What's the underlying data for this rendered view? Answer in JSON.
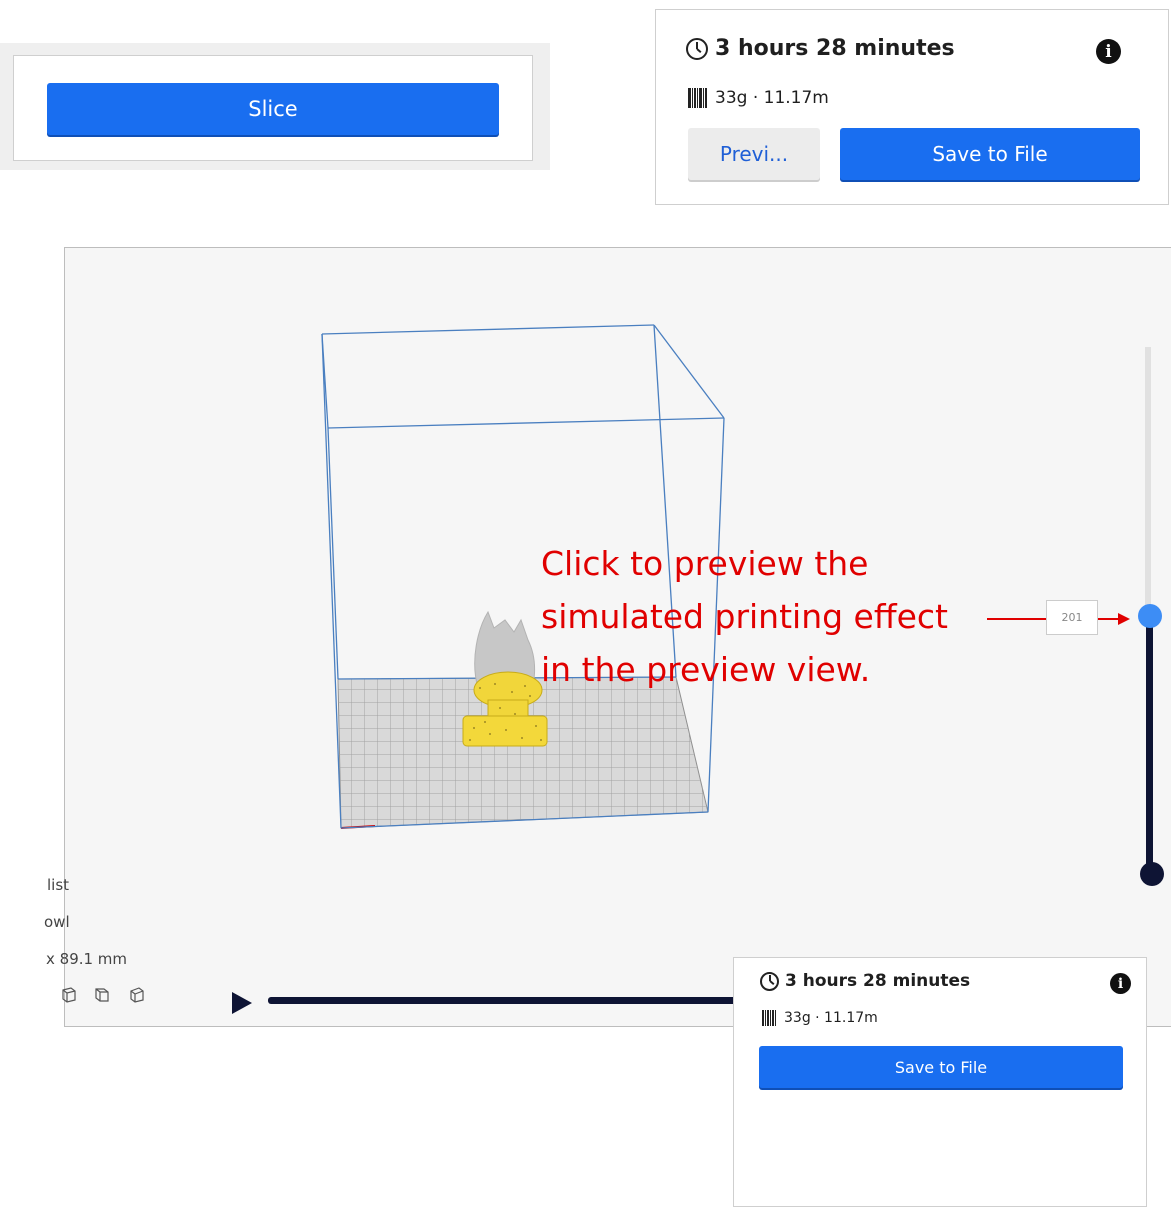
{
  "slice_panel": {
    "slice_label": "Slice"
  },
  "info_panel_top": {
    "print_time": "3 hours 28 minutes",
    "material": "33g · 11.17m",
    "preview_label": "Previ...",
    "save_label": "Save to File"
  },
  "viewport": {
    "layer_value": "201",
    "annotation_lines": [
      "Click to preview the",
      "simulated printing effect",
      "in the preview view."
    ],
    "side_texts": [
      "list",
      "owl",
      "x 89.1 mm"
    ]
  },
  "info_panel_bottom": {
    "print_time": "3 hours 28 minutes",
    "material": "33g · 11.17m",
    "save_label": "Save to File"
  },
  "colors": {
    "primary": "#196ef0",
    "annotation": "#e00000",
    "slider_dark": "#0e1434",
    "slider_handle": "#3d8df5",
    "build_volume": "#4a7fc0",
    "model": "#f3d83a"
  },
  "icons": [
    "clock-icon",
    "info-icon",
    "filament-icon",
    "play-icon",
    "view-icon"
  ]
}
